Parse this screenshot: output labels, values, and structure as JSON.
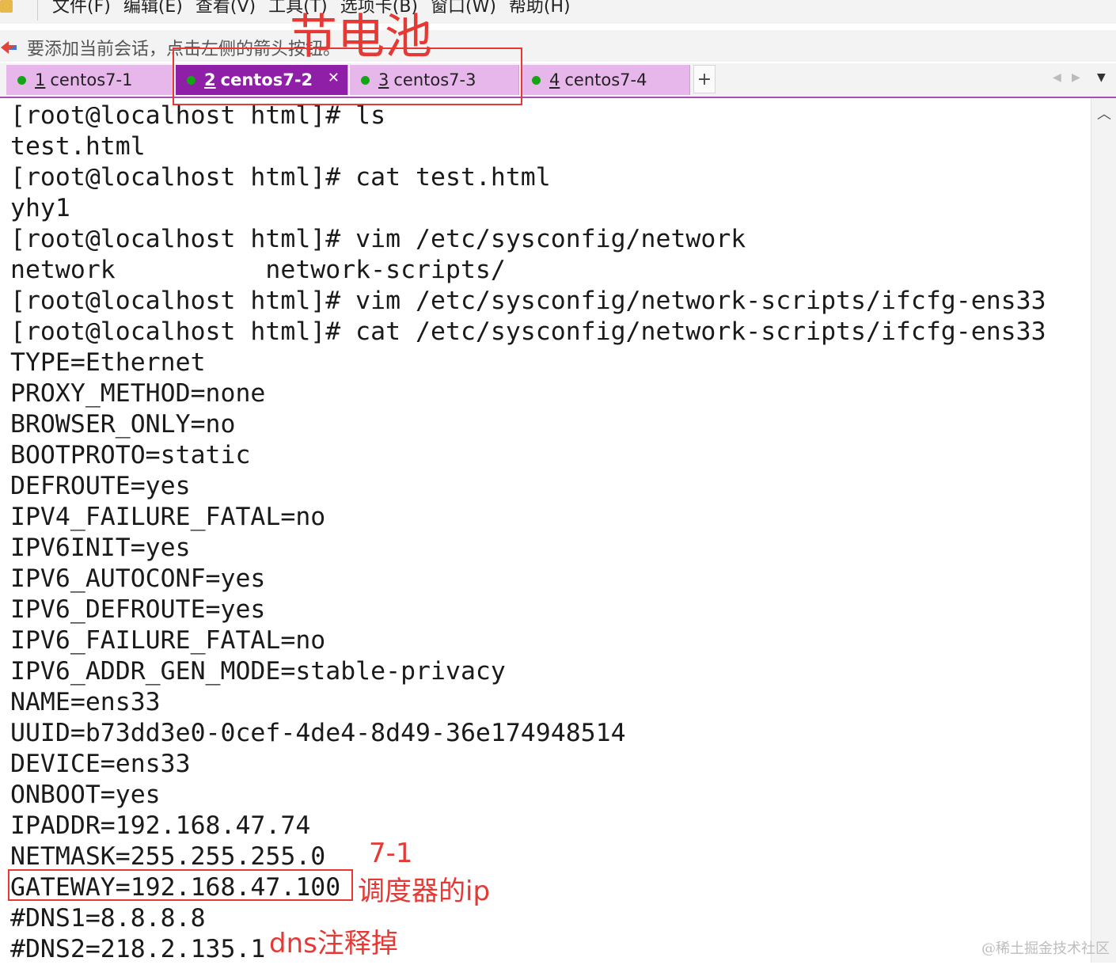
{
  "menu": {
    "items": [
      "文件(F)",
      "编辑(E)",
      "查看(V)",
      "工具(T)",
      "选项卡(B)",
      "窗口(W)",
      "帮助(H)"
    ]
  },
  "hint": {
    "text": "要添加当前会话，点击左侧的箭头按钮。"
  },
  "tabs": [
    {
      "num": "1",
      "label": "centos7-1",
      "active": false
    },
    {
      "num": "2",
      "label": "centos7-2",
      "active": true
    },
    {
      "num": "3",
      "label": "centos7-3",
      "active": false
    },
    {
      "num": "4",
      "label": "centos7-4",
      "active": false
    }
  ],
  "tab_add_label": "+",
  "terminal": {
    "lines": [
      "[root@localhost html]# ls",
      "test.html",
      "[root@localhost html]# cat test.html",
      "yhy1",
      "[root@localhost html]# vim /etc/sysconfig/network",
      "network          network-scripts/",
      "[root@localhost html]# vim /etc/sysconfig/network-scripts/ifcfg-ens33",
      "[root@localhost html]# cat /etc/sysconfig/network-scripts/ifcfg-ens33",
      "TYPE=Ethernet",
      "PROXY_METHOD=none",
      "BROWSER_ONLY=no",
      "BOOTPROTO=static",
      "DEFROUTE=yes",
      "IPV4_FAILURE_FATAL=no",
      "IPV6INIT=yes",
      "IPV6_AUTOCONF=yes",
      "IPV6_DEFROUTE=yes",
      "IPV6_FAILURE_FATAL=no",
      "IPV6_ADDR_GEN_MODE=stable-privacy",
      "NAME=ens33",
      "UUID=b73dd3e0-0cef-4de4-8d49-36e174948514",
      "DEVICE=ens33",
      "ONBOOT=yes",
      "IPADDR=192.168.47.74",
      "NETMASK=255.255.255.0",
      "GATEWAY=192.168.47.100",
      "#DNS1=8.8.8.8",
      "#DNS2=218.2.135.1"
    ]
  },
  "annotations": {
    "battery_saver": "节电池",
    "tab_ref": "7-1",
    "gateway_note": "调度器的ip",
    "dns_note": "dns注释掉"
  },
  "watermark": "@稀土掘金技术社区",
  "colors": {
    "tab_inactive": "#e7b6ea",
    "tab_active": "#8f1fa6",
    "status_dot": "#14a514",
    "annotation_red": "#e53935"
  },
  "icons": {
    "scroll_up": "chevron-up-icon",
    "tab_close": "close-icon",
    "nav_left": "chevron-left-icon",
    "nav_right": "chevron-right-icon",
    "tab_menu": "caret-down-icon"
  }
}
